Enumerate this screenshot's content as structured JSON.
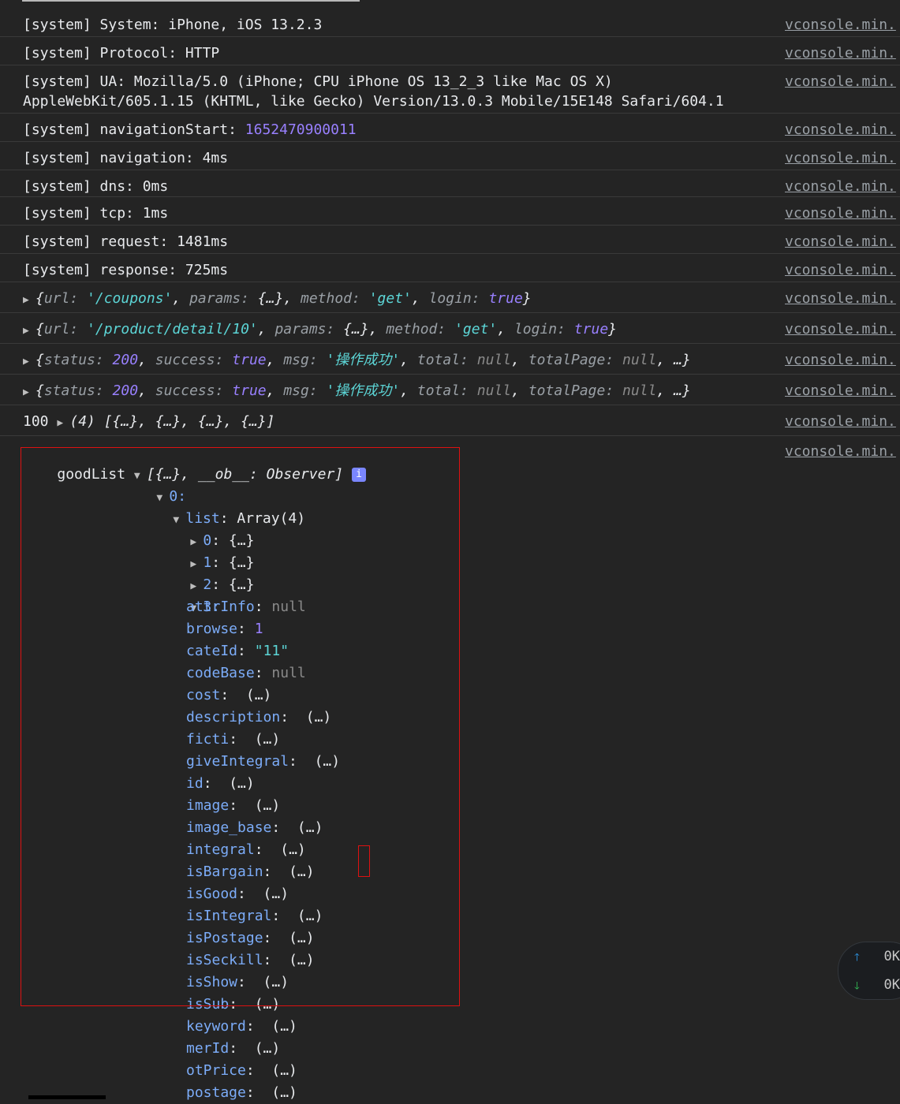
{
  "source_label": "vconsole.min.",
  "system_rows": [
    {
      "text": "[system] System: iPhone, iOS 13.2.3"
    },
    {
      "text": "[system] Protocol: HTTP"
    },
    {
      "text": "[system] UA: Mozilla/5.0 (iPhone; CPU iPhone OS 13_2_3 like Mac OS X)\nAppleWebKit/605.1.15 (KHTML, like Gecko) Version/13.0.3 Mobile/15E148 Safari/604.1"
    },
    {
      "label": "[system] navigationStart: ",
      "value": "1652470900011"
    },
    {
      "text": "[system] navigation: 4ms"
    },
    {
      "text": "[system] dns: 0ms"
    },
    {
      "text": "[system] tcp: 1ms"
    },
    {
      "text": "[system] request: 1481ms"
    },
    {
      "text": "[system] response: 725ms"
    }
  ],
  "obj_rows": {
    "coupons": {
      "url": "'/coupons'",
      "params": "{…}",
      "method": "'get'",
      "login": "true"
    },
    "detail": {
      "url": "'/product/detail/10'",
      "params": "{…}",
      "method": "'get'",
      "login": "true"
    },
    "res1": {
      "status": "200",
      "success": "true",
      "msg": "'操作成功'",
      "total": "null",
      "totalPage": "null",
      "rest": "…}"
    },
    "res2": {
      "status": "200",
      "success": "true",
      "msg": "'操作成功'",
      "total": "null",
      "totalPage": "null",
      "rest": "…}"
    },
    "hundred": {
      "num": "100",
      "summary": "(4) [{…}, {…}, {…}, {…}]"
    }
  },
  "tree": {
    "root_label": "goodList",
    "root_summary": "[{…}, __ob__: Observer]",
    "info_icon": "i",
    "idx0": "0:",
    "list_label": "list",
    "list_value": "Array(4)",
    "collapsed": [
      {
        "key": "0",
        "value": "{…}"
      },
      {
        "key": "1",
        "value": "{…}"
      },
      {
        "key": "2",
        "value": "{…}"
      }
    ],
    "idx3": "3:",
    "props": [
      {
        "key": "attrInfo",
        "value": "null",
        "kind": "null"
      },
      {
        "key": "browse",
        "value": "1",
        "kind": "num"
      },
      {
        "key": "cateId",
        "value": "\"11\"",
        "kind": "str"
      },
      {
        "key": "codeBase",
        "value": "null",
        "kind": "null"
      },
      {
        "key": "cost",
        "value": " (…)",
        "kind": "lazy"
      },
      {
        "key": "description",
        "value": " (…)",
        "kind": "lazy"
      },
      {
        "key": "ficti",
        "value": " (…)",
        "kind": "lazy"
      },
      {
        "key": "giveIntegral",
        "value": " (…)",
        "kind": "lazy"
      },
      {
        "key": "id",
        "value": " (…)",
        "kind": "lazy"
      },
      {
        "key": "image",
        "value": " (…)",
        "kind": "lazy"
      },
      {
        "key": "image_base",
        "value": " (…)",
        "kind": "lazy"
      },
      {
        "key": "integral",
        "value": " (…)",
        "kind": "lazy"
      },
      {
        "key": "isBargain",
        "value": " (…)",
        "kind": "lazy"
      },
      {
        "key": "isGood",
        "value": " (…)",
        "kind": "lazy"
      },
      {
        "key": "isIntegral",
        "value": " (…)",
        "kind": "lazy"
      },
      {
        "key": "isPostage",
        "value": " (…)",
        "kind": "lazy"
      },
      {
        "key": "isSeckill",
        "value": " (…)",
        "kind": "lazy"
      },
      {
        "key": "isShow",
        "value": " (…)",
        "kind": "lazy"
      },
      {
        "key": "isSub",
        "value": " (…)",
        "kind": "lazy"
      },
      {
        "key": "keyword",
        "value": " (…)",
        "kind": "lazy"
      },
      {
        "key": "merId",
        "value": " (…)",
        "kind": "lazy"
      },
      {
        "key": "otPrice",
        "value": " (…)",
        "kind": "lazy"
      },
      {
        "key": "postage",
        "value": " (…)",
        "kind": "lazy"
      }
    ]
  },
  "network_panel": {
    "up": "0K",
    "down": "0K"
  }
}
